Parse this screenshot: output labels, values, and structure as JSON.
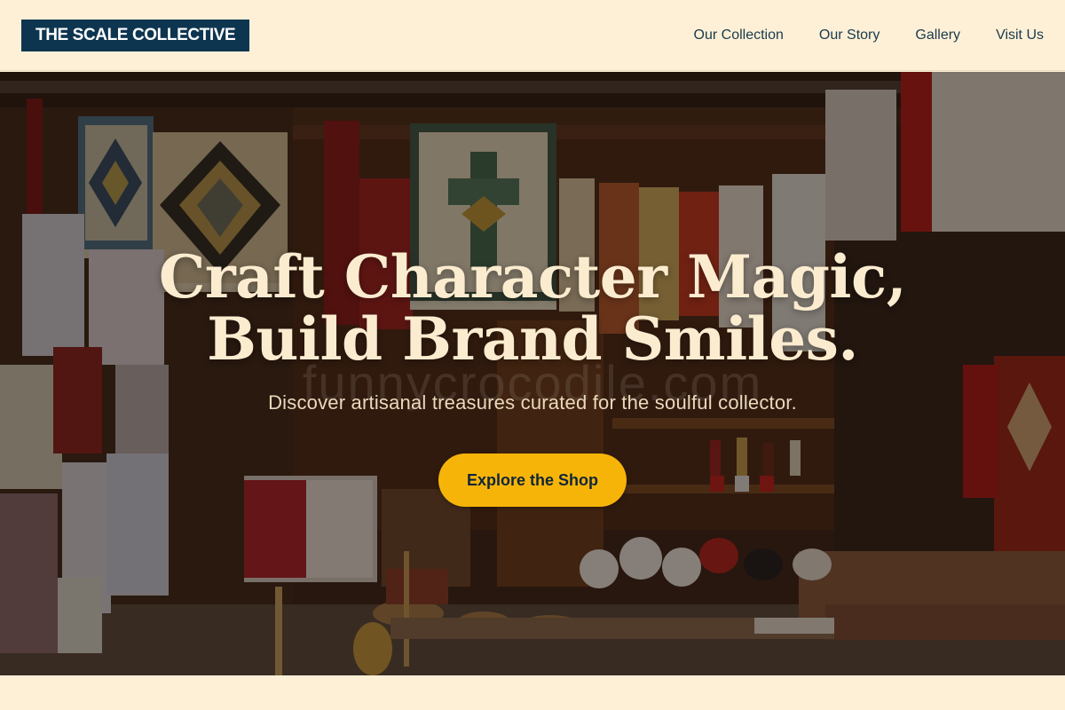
{
  "brand": {
    "name": "THE SCALE COLLECTIVE"
  },
  "nav": {
    "items": [
      {
        "label": "Our Collection"
      },
      {
        "label": "Our Story"
      },
      {
        "label": "Gallery"
      },
      {
        "label": "Visit Us"
      }
    ]
  },
  "hero": {
    "title_line1": "Craft Character Magic,",
    "title_line2": "Build Brand Smiles.",
    "subtitle": "Discover artisanal treasures curated for the soulful collector.",
    "cta_label": "Explore the Shop",
    "watermark": "funnycrocodile.com"
  },
  "colors": {
    "background": "#fdf0d6",
    "logo_bg": "#0e3550",
    "cta_bg": "#f7b408",
    "nav_text": "#1b3a4d"
  }
}
